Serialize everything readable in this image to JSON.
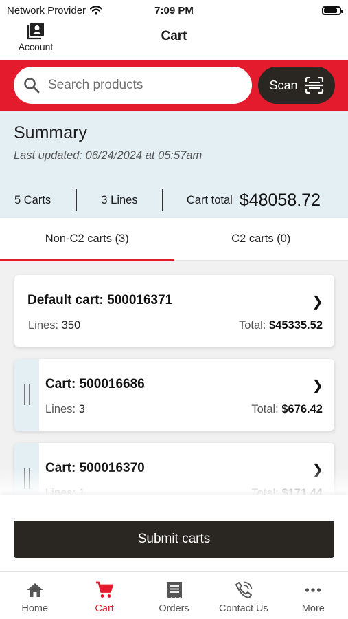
{
  "status_bar": {
    "carrier": "Network Provider",
    "time": "7:09 PM",
    "battery_level": 0.85
  },
  "header": {
    "title": "Cart",
    "account_label": "Account"
  },
  "search": {
    "placeholder": "Search products",
    "scan_label": "Scan"
  },
  "summary": {
    "title": "Summary",
    "last_updated": "Last updated: 06/24/2024 at 05:57am",
    "carts": "5 Carts",
    "lines": "3 Lines",
    "cart_total_label": "Cart total",
    "cart_total_value": "$48058.72"
  },
  "tabs": [
    {
      "label": "Non-C2 carts (3)",
      "active": true
    },
    {
      "label": "C2 carts (0)",
      "active": false
    }
  ],
  "carts": [
    {
      "title": "Default cart: 500016371",
      "lines_label": "Lines:",
      "lines_value": "350",
      "total_label": "Total:",
      "total_value": "$45335.52"
    },
    {
      "title": "Cart: 500016686",
      "lines_label": "Lines:",
      "lines_value": "3",
      "total_label": "Total:",
      "total_value": "$676.42"
    },
    {
      "title": "Cart: 500016370",
      "lines_label": "Lines:",
      "lines_value": "1",
      "total_label": "Total:",
      "total_value": "$171.44"
    }
  ],
  "submit": {
    "label": "Submit carts"
  },
  "nav": [
    {
      "label": "Home",
      "icon": "home-icon",
      "active": false
    },
    {
      "label": "Cart",
      "icon": "cart-icon",
      "active": true
    },
    {
      "label": "Orders",
      "icon": "orders-icon",
      "active": false
    },
    {
      "label": "Contact Us",
      "icon": "phone-icon",
      "active": false
    },
    {
      "label": "More",
      "icon": "more-icon",
      "active": false
    }
  ],
  "colors": {
    "brand_red": "#e41b2d",
    "dark": "#2a2621",
    "summary_bg": "#e3eff3"
  }
}
